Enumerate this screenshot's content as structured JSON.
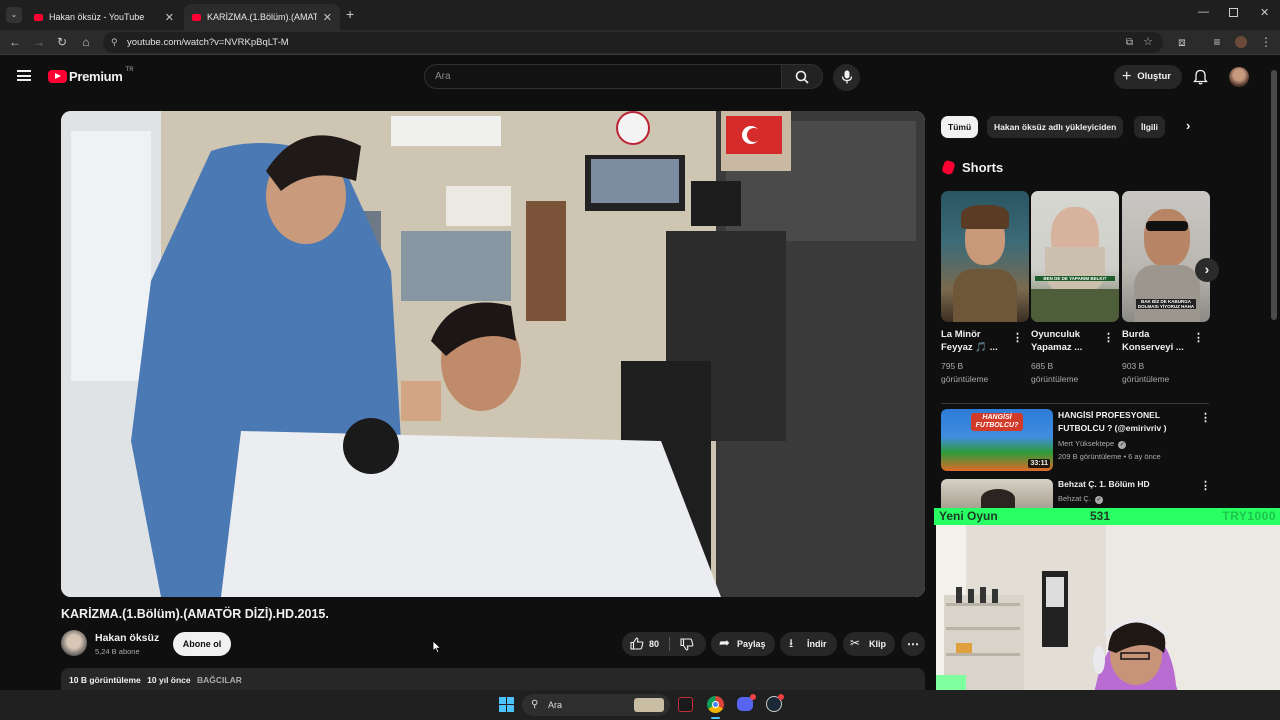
{
  "browser": {
    "tabs": [
      {
        "title": "Hakan öksüz - YouTube"
      },
      {
        "title": "KARİZMA.(1.Bölüm).(AMATÖR D"
      }
    ],
    "url": "youtube.com/watch?v=NVRKpBqLT-M"
  },
  "header": {
    "logo": "Premium",
    "region": "TR",
    "search_placeholder": "Ara",
    "create_label": "Oluştur"
  },
  "video": {
    "title": "KARİZMA.(1.Bölüm).(AMATÖR DİZİ).HD.2015.",
    "channel": "Hakan öksüz",
    "subscribers": "5,24 B abone",
    "subscribe_label": "Abone ol",
    "likes": "80",
    "share_label": "Paylaş",
    "download_label": "İndir",
    "clip_label": "Klip",
    "views": "10 B görüntüleme",
    "age": "10 yıl önce",
    "location": "BAĞCILAR"
  },
  "sidebar": {
    "chips": [
      "Tümü",
      "Hakan öksüz adlı yükleyiciden",
      "İlgili"
    ],
    "shorts_heading": "Shorts",
    "shorts": [
      {
        "title": "La Minör Feyyaz 🎵 ...",
        "views": "795 B görüntüleme",
        "overlay": ""
      },
      {
        "title": "Oyunculuk Yapamaz ...",
        "views": "685 B görüntüleme",
        "overlay": "BEN DE DE YAPARIM BELKI?"
      },
      {
        "title": "Burda Konserveyi ...",
        "views": "903 B görüntüleme",
        "overlay": "BAK BİZ DE KABURGA DOLMASI YİYORUZ HAHA"
      }
    ],
    "videos": [
      {
        "title": "HANGİSİ PROFESYONEL FUTBOLCU ? (@emirivriv )",
        "channel": "Mert Yüksektepe",
        "meta": "209 B görüntüleme • 6 ay önce",
        "duration": "33:11",
        "thumb_text": "HANGİSİ FUTBOLCU?"
      },
      {
        "title": "Behzat Ç. 1. Bölüm HD",
        "channel": "Behzat Ç.",
        "meta": "",
        "duration": "",
        "thumb_text": ""
      }
    ]
  },
  "overlay": {
    "label": "Yeni Oyun",
    "count": "531",
    "code": "TRY1000"
  },
  "taskbar": {
    "search_label": "Ara"
  },
  "colors": {
    "youtube_red": "#ff0033",
    "overlay_green": "#28ff62",
    "background": "#0f0f0f"
  }
}
